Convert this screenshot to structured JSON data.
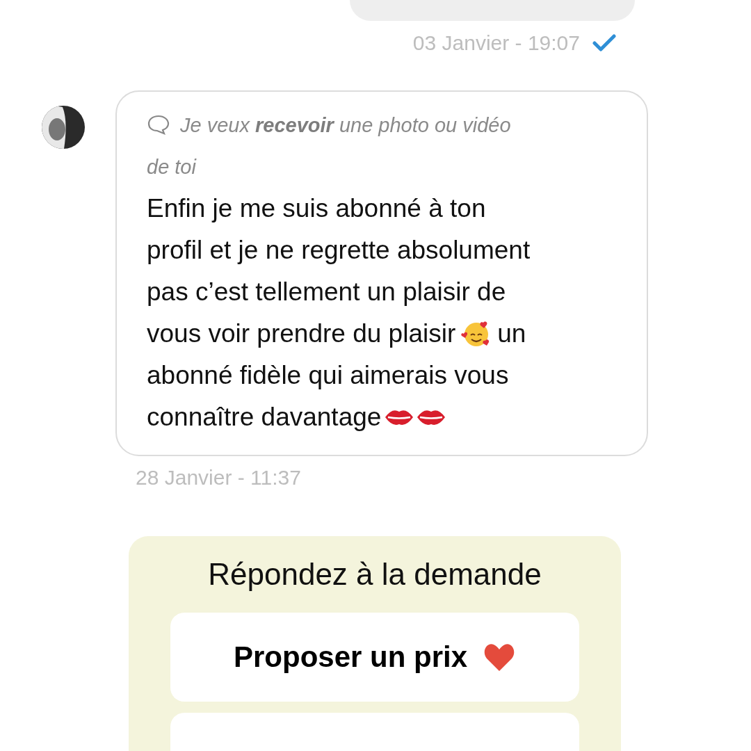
{
  "sent_message": {
    "timestamp": "03 Janvier - 19:07",
    "read": true
  },
  "received_message": {
    "request_lines": [
      "Je veux **recevoir** une photo ou vidéo",
      "de toi"
    ],
    "body_lines": [
      [
        {
          "kind": "text",
          "text": "Enfin je me suis abonné à ton"
        }
      ],
      [
        {
          "kind": "text",
          "text": "profil et je ne regrette absolument"
        }
      ],
      [
        {
          "kind": "text",
          "text": "pas c’est tellement un plaisir de"
        }
      ],
      [
        {
          "kind": "text",
          "text": "vous voir prendre du plaisir"
        },
        {
          "kind": "hearts-face"
        },
        {
          "kind": "text",
          "text": "un"
        }
      ],
      [
        {
          "kind": "text",
          "text": "abonné fidèle qui aimerais vous"
        }
      ],
      [
        {
          "kind": "text",
          "text": "connaître davantage"
        },
        {
          "kind": "kiss"
        },
        {
          "kind": "kiss"
        }
      ]
    ],
    "timestamp": "28 Janvier - 11:37"
  },
  "reply_panel": {
    "title": "Répondez à la demande",
    "buttons": [
      {
        "kind": "labeled",
        "label": "Proposer un prix"
      },
      {
        "kind": "cut-off"
      }
    ]
  }
}
